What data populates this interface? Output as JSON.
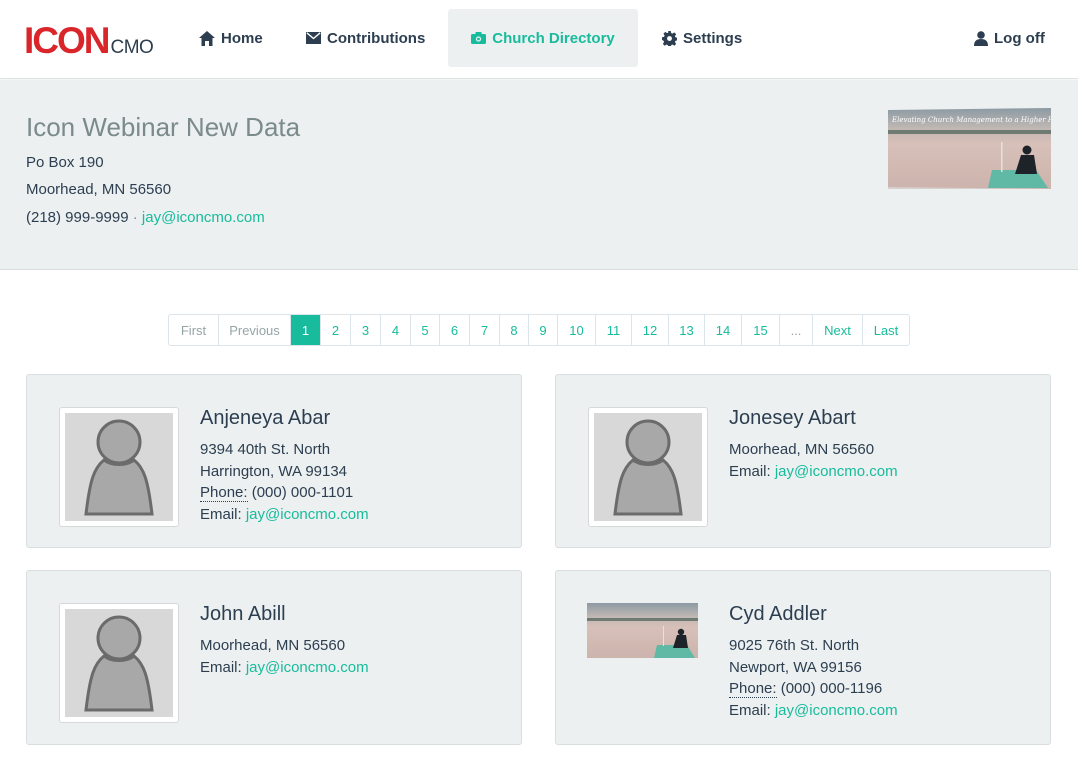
{
  "brand": {
    "main": "ICON",
    "sub": "CMO"
  },
  "nav": {
    "home": "Home",
    "contributions": "Contributions",
    "directory": "Church Directory",
    "settings": "Settings",
    "logoff": "Log off"
  },
  "church": {
    "name": "Icon Webinar New Data",
    "address1": "Po Box 190",
    "address2": "Moorhead, MN 56560",
    "phone": "(218) 999-9999",
    "separator": " · ",
    "email": "jay@iconcmo.com",
    "banner_text": "Elevating Church Management to a Higher Place"
  },
  "pagination": [
    "First",
    "Previous",
    "1",
    "2",
    "3",
    "4",
    "5",
    "6",
    "7",
    "8",
    "9",
    "10",
    "11",
    "12",
    "13",
    "14",
    "15",
    "...",
    "Next",
    "Last"
  ],
  "members": [
    {
      "name": "Anjeneya Abar",
      "line1": "9394 40th St. North",
      "line2": "Harrington, WA 99134",
      "phone_label": "Phone:",
      "phone": " (000) 000-1101",
      "email_label": "Email: ",
      "email": "jay@iconcmo.com"
    },
    {
      "name": "Jonesey Abart",
      "line1": "Moorhead, MN 56560",
      "email_label": "Email: ",
      "email": "jay@iconcmo.com"
    },
    {
      "name": "John Abill",
      "line1": "Moorhead, MN 56560",
      "email_label": "Email: ",
      "email": "jay@iconcmo.com"
    },
    {
      "name": "Cyd Addler",
      "line1": "9025 76th St. North",
      "line2": "Newport, WA 99156",
      "phone_label": "Phone:",
      "phone": " (000) 000-1196",
      "email_label": "Email: ",
      "email": "jay@iconcmo.com"
    }
  ],
  "colors": {
    "accent": "#18bc9c",
    "brand_red": "#d9262b",
    "text": "#2c3e50",
    "panel": "#ecf0f1"
  }
}
